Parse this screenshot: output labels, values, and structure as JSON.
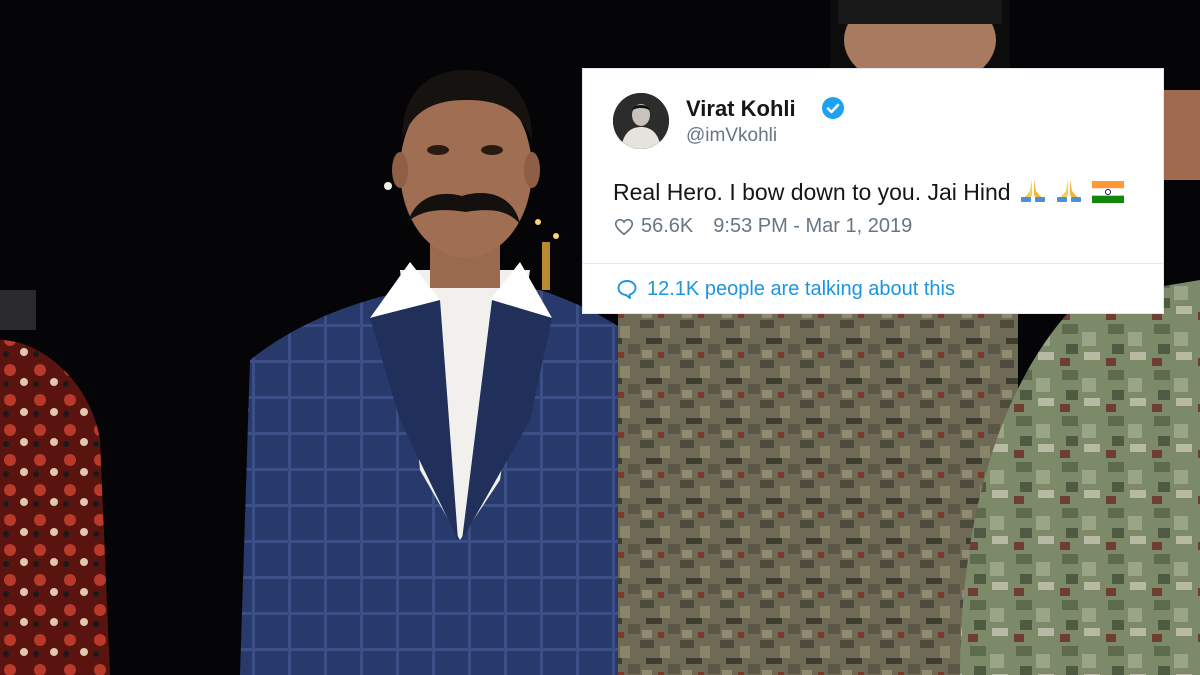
{
  "tweet": {
    "display_name": "Virat Kohli",
    "handle": "@imVkohli",
    "verified": true,
    "text": "Real Hero. I bow down to you. Jai Hind",
    "emojis": [
      "folded-hands-icon",
      "folded-hands-icon",
      "india-flag-icon"
    ],
    "likes": "56.6K",
    "timestamp": "9:53 PM - Mar 1, 2019",
    "conversation": "12.1K people are talking about this"
  },
  "colors": {
    "link": "#1b95e0",
    "verified": "#1da1f2",
    "secondary_text": "#657786",
    "primary_text": "#14171a"
  }
}
